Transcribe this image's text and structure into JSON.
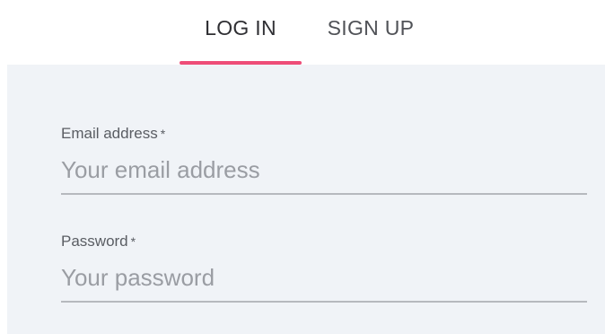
{
  "tabs": {
    "login_label": "LOG IN",
    "signup_label": "SIGN UP",
    "active": "login"
  },
  "colors": {
    "accent": "#ee4d78",
    "panel_background": "#f0f3f7"
  },
  "form": {
    "email": {
      "label": "Email address",
      "required_mark": "*",
      "placeholder": "Your email address",
      "value": ""
    },
    "password": {
      "label": "Password",
      "required_mark": "*",
      "placeholder": "Your password",
      "value": ""
    }
  }
}
